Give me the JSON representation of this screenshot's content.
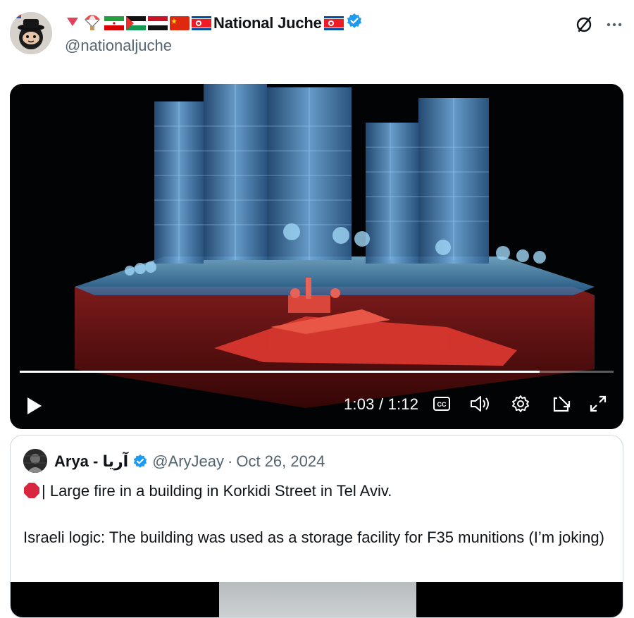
{
  "author": {
    "name": "National Juche",
    "handle": "@nationaljuche",
    "verified": true,
    "verified_color": "#1d9bf0"
  },
  "video": {
    "elapsed": "1:03",
    "separator": "/",
    "duration": "1:12",
    "progress_fraction": 0.875
  },
  "quoted_post": {
    "name": "Arya - آریا",
    "handle": "@AryJeay",
    "dot": "·",
    "date": "Oct 26, 2024",
    "line1": "| Large fire in a building in Korkidi Street in Tel Aviv.",
    "line2": "Israeli logic: The building was used as a storage facility for F35 munitions (I’m joking)"
  },
  "icons": [
    "avatar",
    "red-triangle-icon",
    "parachute-icon",
    "iran-flag-icon",
    "palestine-flag-icon",
    "yemen-flag-icon",
    "china-flag-icon",
    "north-korea-flag-icon",
    "verified-badge-icon",
    "grok-icon",
    "more-icon",
    "play-icon",
    "captions-icon",
    "volume-icon",
    "settings-icon",
    "pip-icon",
    "fullscreen-icon",
    "stop-sign-icon"
  ]
}
